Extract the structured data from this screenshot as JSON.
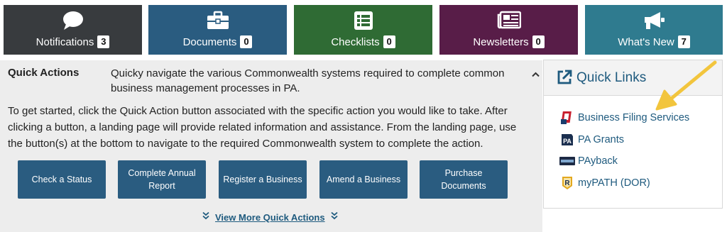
{
  "tiles": [
    {
      "label": "Notifications",
      "count": "3",
      "icon": "comment-icon",
      "color": "#383b3e"
    },
    {
      "label": "Documents",
      "count": "0",
      "icon": "briefcase-icon",
      "color": "#2a5c80"
    },
    {
      "label": "Checklists",
      "count": "0",
      "icon": "checklist-icon",
      "color": "#2f6b34"
    },
    {
      "label": "Newsletters",
      "count": "0",
      "icon": "newspaper-icon",
      "color": "#581d48"
    },
    {
      "label": "What's New",
      "count": "7",
      "icon": "megaphone-icon",
      "color": "#2f7b8f"
    }
  ],
  "quick_actions": {
    "title": "Quick Actions",
    "description": "Quicky navigate the various Commonwealth systems required to complete common business management processes in PA.",
    "body": "To get started, click the Quick Action button associated with the specific action you would like to take. After clicking a button, a landing page will provide related information and assistance. From the landing page, use the button(s) at the bottom to navigate to the required Commonwealth system to complete the action.",
    "buttons": [
      "Check a Status",
      "Complete Annual Report",
      "Register a Business",
      "Amend a Business",
      "Purchase Documents"
    ],
    "view_more": "View More Quick Actions"
  },
  "quick_links": {
    "title": "Quick Links",
    "items": [
      {
        "label": "Business Filing Services",
        "icon": "business-filing-logo-icon"
      },
      {
        "label": "PA Grants",
        "icon": "pa-grants-logo-icon"
      },
      {
        "label": "PAyback",
        "icon": "payback-logo-icon"
      },
      {
        "label": "myPATH (DOR)",
        "icon": "mypath-logo-icon"
      }
    ]
  },
  "colors": {
    "accent": "#1e5a7e",
    "arrow": "#f2c53d"
  }
}
